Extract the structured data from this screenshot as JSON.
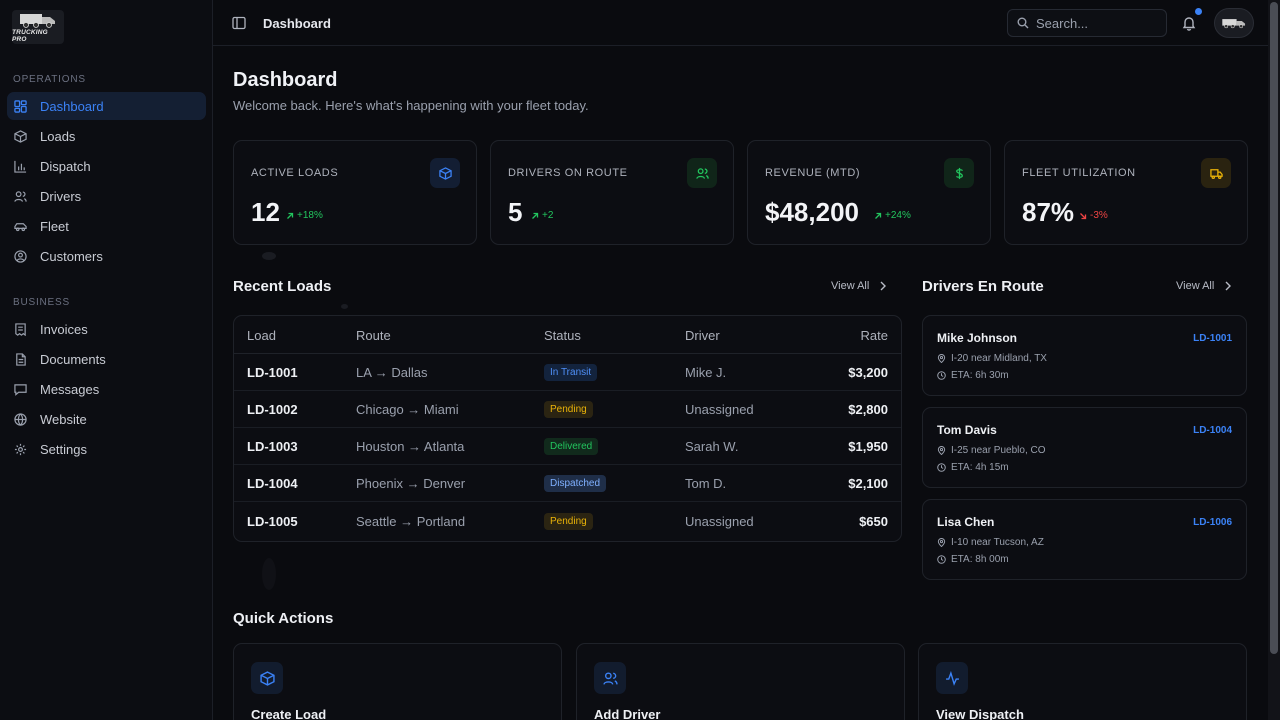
{
  "app": {
    "logo_text": "TRUCKING PRO",
    "breadcrumb": "Dashboard"
  },
  "sidebar": {
    "sections": [
      {
        "label": "OPERATIONS",
        "items": [
          {
            "label": "Dashboard",
            "icon": "grid-icon",
            "active": true
          },
          {
            "label": "Loads",
            "icon": "box-icon"
          },
          {
            "label": "Dispatch",
            "icon": "bar-chart-icon"
          },
          {
            "label": "Drivers",
            "icon": "users-icon"
          },
          {
            "label": "Fleet",
            "icon": "car-icon"
          },
          {
            "label": "Customers",
            "icon": "user-circle-icon"
          }
        ]
      },
      {
        "label": "BUSINESS",
        "items": [
          {
            "label": "Invoices",
            "icon": "receipt-icon"
          },
          {
            "label": "Documents",
            "icon": "document-icon"
          },
          {
            "label": "Messages",
            "icon": "message-icon"
          },
          {
            "label": "Website",
            "icon": "globe-icon"
          },
          {
            "label": "Settings",
            "icon": "gear-icon"
          }
        ]
      }
    ]
  },
  "search": {
    "placeholder": "Search..."
  },
  "header": {
    "title": "Dashboard",
    "subtitle": "Welcome back. Here's what's happening with your fleet today."
  },
  "stats": [
    {
      "label": "ACTIVE LOADS",
      "value": "12",
      "delta": "+18%",
      "trend": "up",
      "icon": "box-icon",
      "accent": "#3b82f6"
    },
    {
      "label": "DRIVERS ON ROUTE",
      "value": "5",
      "delta": "+2",
      "trend": "up",
      "icon": "users-icon",
      "accent": "#22c55e"
    },
    {
      "label": "REVENUE (MTD)",
      "value": "$48,200",
      "delta": "+24%",
      "trend": "up",
      "icon": "dollar-icon",
      "accent": "#22c55e"
    },
    {
      "label": "FLEET UTILIZATION",
      "value": "87%",
      "delta": "-3%",
      "trend": "down",
      "icon": "truck-icon",
      "accent": "#eab308"
    }
  ],
  "recent_loads": {
    "title": "Recent Loads",
    "view_all": "View All",
    "columns": [
      "Load",
      "Route",
      "Status",
      "Driver",
      "Rate"
    ],
    "rows": [
      {
        "load": "LD-1001",
        "route": "LA → Dallas",
        "status": "In Transit",
        "status_kind": "transit",
        "driver": "Mike J.",
        "rate": "$3,200"
      },
      {
        "load": "LD-1002",
        "route": "Chicago → Miami",
        "status": "Pending",
        "status_kind": "pending",
        "driver": "Unassigned",
        "rate": "$2,800"
      },
      {
        "load": "LD-1003",
        "route": "Houston → Atlanta",
        "status": "Delivered",
        "status_kind": "delivered",
        "driver": "Sarah W.",
        "rate": "$1,950"
      },
      {
        "load": "LD-1004",
        "route": "Phoenix → Denver",
        "status": "Dispatched",
        "status_kind": "dispatched",
        "driver": "Tom D.",
        "rate": "$2,100"
      },
      {
        "load": "LD-1005",
        "route": "Seattle → Portland",
        "status": "Pending",
        "status_kind": "pending",
        "driver": "Unassigned",
        "rate": "$650"
      }
    ]
  },
  "drivers_en_route": {
    "title": "Drivers En Route",
    "view_all": "View All",
    "drivers": [
      {
        "name": "Mike Johnson",
        "load": "LD-1001",
        "location": "I-20 near Midland, TX",
        "eta": "ETA: 6h 30m"
      },
      {
        "name": "Tom Davis",
        "load": "LD-1004",
        "location": "I-25 near Pueblo, CO",
        "eta": "ETA: 4h 15m"
      },
      {
        "name": "Lisa Chen",
        "load": "LD-1006",
        "location": "I-10 near Tucson, AZ",
        "eta": "ETA: 8h 00m"
      }
    ]
  },
  "quick_actions": {
    "title": "Quick Actions",
    "items": [
      {
        "label": "Create Load",
        "icon": "box-icon"
      },
      {
        "label": "Add Driver",
        "icon": "users-icon"
      },
      {
        "label": "View Dispatch",
        "icon": "activity-icon"
      }
    ]
  }
}
